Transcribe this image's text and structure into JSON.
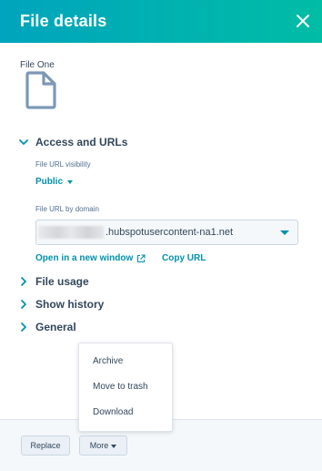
{
  "header": {
    "title": "File details",
    "close_icon": "close-icon"
  },
  "file": {
    "name": "File One",
    "icon": "file-icon"
  },
  "sections": {
    "access": {
      "label": "Access and URLs",
      "expanded": true,
      "visibility_label": "File URL visibility",
      "visibility_value": "Public",
      "domain_label": "File URL by domain",
      "domain_value": ".hubspotusercontent-na1.net",
      "open_link": "Open in a new window",
      "copy_link": "Copy URL"
    },
    "usage": {
      "label": "File usage",
      "expanded": false
    },
    "history": {
      "label": "Show history",
      "expanded": false
    },
    "general": {
      "label": "General",
      "expanded": false
    }
  },
  "more_menu": {
    "items": [
      "Archive",
      "Move to trash",
      "Download"
    ]
  },
  "footer": {
    "replace_label": "Replace",
    "more_label": "More"
  },
  "colors": {
    "header_gradient_start": "#00a4bd",
    "header_gradient_end": "#00bda5",
    "link": "#0091ae",
    "text": "#33475b",
    "file_icon": "#7c98b6"
  }
}
